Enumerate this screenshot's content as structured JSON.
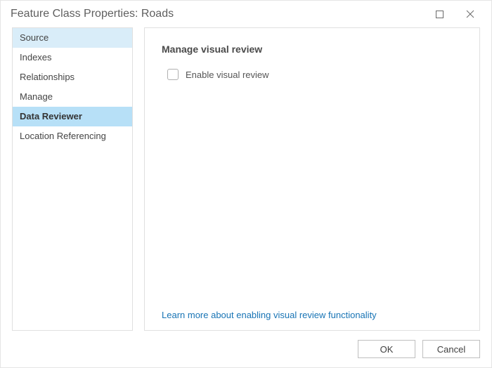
{
  "titlebar": {
    "title": "Feature Class Properties: Roads"
  },
  "sidebar": {
    "items": [
      {
        "label": "Source",
        "highlight": true,
        "selected": false
      },
      {
        "label": "Indexes",
        "highlight": false,
        "selected": false
      },
      {
        "label": "Relationships",
        "highlight": false,
        "selected": false
      },
      {
        "label": "Manage",
        "highlight": false,
        "selected": false
      },
      {
        "label": "Data Reviewer",
        "highlight": false,
        "selected": true
      },
      {
        "label": "Location Referencing",
        "highlight": false,
        "selected": false
      }
    ]
  },
  "main": {
    "section_title": "Manage visual review",
    "enable_checkbox": {
      "label": "Enable visual review",
      "checked": false
    },
    "help_link": "Learn more about enabling visual review functionality"
  },
  "footer": {
    "ok_label": "OK",
    "cancel_label": "Cancel"
  }
}
